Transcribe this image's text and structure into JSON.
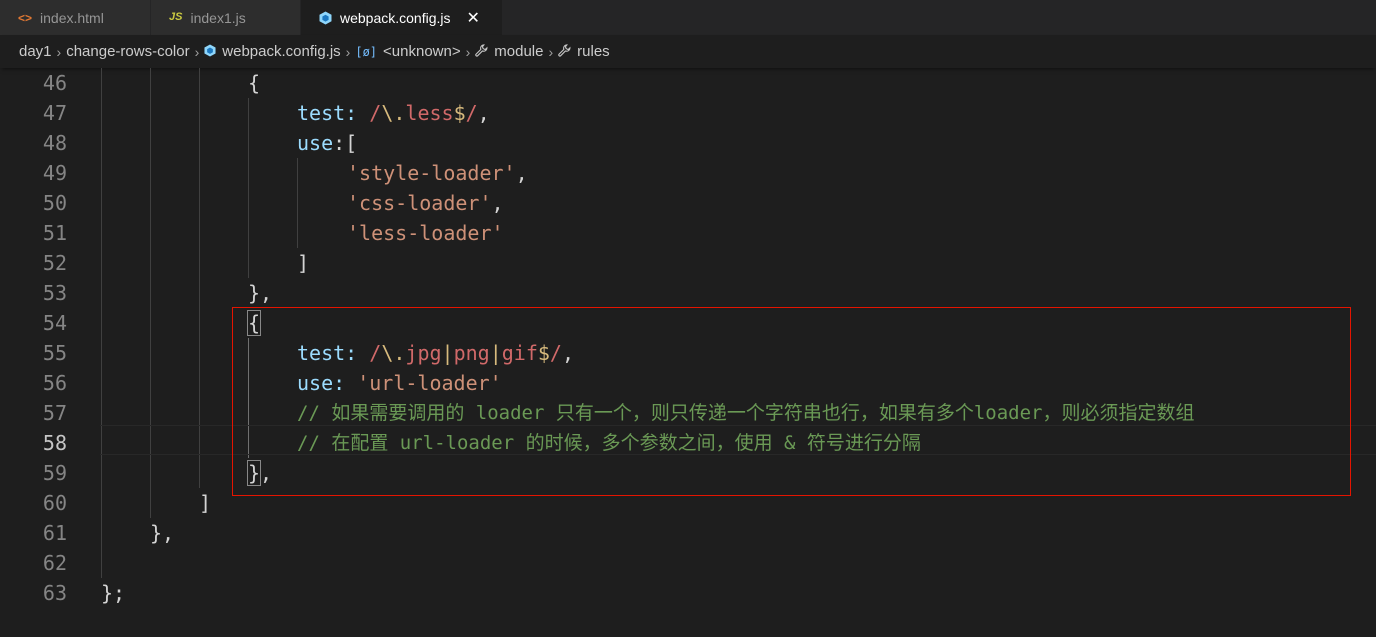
{
  "tabs": [
    {
      "icon": "html-file-icon",
      "glyph": "<>",
      "label": "index.html"
    },
    {
      "icon": "js-file-icon",
      "glyph": "JS",
      "label": "index1.js"
    },
    {
      "icon": "webpack-file-icon",
      "label": "webpack.config.js",
      "active": true
    }
  ],
  "tab_close_glyph": "✕",
  "breadcrumb": {
    "items": [
      {
        "label": "day1"
      },
      {
        "label": "change-rows-color"
      },
      {
        "label": "webpack.config.js",
        "icon": "webpack-icon"
      },
      {
        "label": "<unknown>",
        "icon": "brackets-icon",
        "glyph": "[ø]"
      },
      {
        "label": "module",
        "icon": "wrench-icon",
        "glyph": "🔧"
      },
      {
        "label": "rules",
        "icon": "wrench-icon",
        "glyph": "🔧"
      }
    ],
    "separator": "›"
  },
  "editor": {
    "active_line": 58,
    "line_numbers": [
      "46",
      "47",
      "48",
      "49",
      "50",
      "51",
      "52",
      "53",
      "54",
      "55",
      "56",
      "57",
      "58",
      "59",
      "60",
      "61",
      "62",
      "63"
    ],
    "code": {
      "l46": {
        "brace": "{"
      },
      "l47": {
        "key": "test",
        "colon": ": ",
        "re_open": "/",
        "re_esc": "\\.",
        "re_body": "less",
        "re_end": "$",
        "re_close": "/",
        "comma": ","
      },
      "l48": {
        "key": "use",
        "rest": ":["
      },
      "l49": {
        "str": "'style-loader'",
        "comma": ","
      },
      "l50": {
        "str": "'css-loader'",
        "comma": ","
      },
      "l51": {
        "str": "'less-loader'"
      },
      "l52": {
        "bracket": "]"
      },
      "l53": {
        "text": "},"
      },
      "l54": {
        "brace": "{"
      },
      "l55": {
        "key": "test",
        "colon": ": ",
        "re_open": "/",
        "re_esc": "\\.",
        "re_a": "jpg",
        "re_pipe1": "|",
        "re_b": "png",
        "re_pipe2": "|",
        "re_c": "gif",
        "re_end": "$",
        "re_close": "/",
        "comma": ","
      },
      "l56": {
        "key": "use",
        "colon": ": ",
        "str": "'url-loader'"
      },
      "l57": {
        "comment": "// 如果需要调用的 loader 只有一个，则只传递一个字符串也行，如果有多个loader，则必须指定数组"
      },
      "l58": {
        "comment": "// 在配置 url-loader 的时候，多个参数之间，使用 & 符号进行分隔"
      },
      "l59": {
        "brace": "}",
        "comma": ","
      },
      "l60": {
        "bracket": "]"
      },
      "l61": {
        "text": "},"
      },
      "l62": {
        "text": ""
      },
      "l63": {
        "text": "};"
      }
    }
  },
  "colors": {
    "background": "#1e1e1e",
    "tabbar": "#252526",
    "keyword": "#9cdcfe",
    "string": "#ce9178",
    "regex": "#d16969",
    "regex_special": "#d7ba7d",
    "comment": "#6a9955",
    "highlight_border": "#e51400"
  }
}
